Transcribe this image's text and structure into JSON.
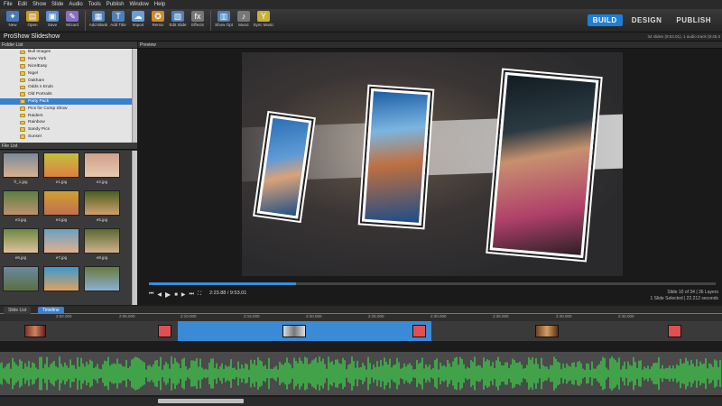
{
  "menu": [
    "File",
    "Edit",
    "Show",
    "Slide",
    "Audio",
    "Tools",
    "Publish",
    "Window",
    "Help"
  ],
  "toolbar": [
    {
      "label": "New",
      "icon": "new-icon",
      "glyph": "✦"
    },
    {
      "label": "Open",
      "icon": "open-icon",
      "glyph": "▤"
    },
    {
      "label": "Save",
      "icon": "save-icon",
      "glyph": "▣"
    },
    {
      "label": "Wizard",
      "icon": "wizard-icon",
      "glyph": "✎"
    },
    {
      "label": "Add Blank",
      "icon": "add-blank-icon",
      "glyph": "▦"
    },
    {
      "label": "Add Title",
      "icon": "add-title-icon",
      "glyph": "T"
    },
    {
      "label": "Import",
      "icon": "import-icon",
      "glyph": "☁"
    },
    {
      "label": "Remix",
      "icon": "remix-icon",
      "glyph": "✪"
    },
    {
      "label": "Edit Slide",
      "icon": "edit-slide-icon",
      "glyph": "▧"
    },
    {
      "label": "Effects",
      "icon": "effects-icon",
      "glyph": "fx"
    },
    {
      "label": "Show Opt",
      "icon": "show-opt-icon",
      "glyph": "▥"
    },
    {
      "label": "Music",
      "icon": "music-icon",
      "glyph": "♪"
    },
    {
      "label": "Sync Music",
      "icon": "sync-music-icon",
      "glyph": "Y"
    }
  ],
  "modes": {
    "build": "BUILD",
    "design": "DESIGN",
    "publish": "PUBLISH"
  },
  "project": {
    "title": "ProShow Slideshow",
    "info": "34 slides (9:53.01), 1 audio track (9:45.3"
  },
  "folder_panel": {
    "title": "Folder List",
    "items": [
      "Bull Images",
      "New York",
      "NicelEasy",
      "Nigel",
      "Oakham",
      "Odds n Ends",
      "Old Portraits",
      "Party Pack",
      "Pics for Comp Show",
      "Raiders",
      "Rainbow",
      "Sandy Pics",
      "Sunset"
    ],
    "selected": 7
  },
  "file_panel": {
    "title": "File List",
    "files": [
      "fr_1.jpg",
      "e1.jpg",
      "e2.jpg",
      "e3.jpg",
      "e4.jpg",
      "e5.jpg",
      "e6.jpg",
      "e7.jpg",
      "e8.jpg",
      "",
      "",
      ""
    ]
  },
  "preview": {
    "title": "Preview"
  },
  "transport": {
    "timecode": "2:23.88 / 9:53.01",
    "slide_info": "Slide 10 of 34 | 36 Layers",
    "slide_info2": "1 Slide Selected | 22.212 seconds",
    "progress": 0.26
  },
  "tabs": {
    "slide_list": "Slide List",
    "timeline": "Timeline"
  },
  "ruler": [
    "2:00.000",
    "2:05.000",
    "2:10.000",
    "2:15.000",
    "2:20.000",
    "2:25.000",
    "2:30.000",
    "2:35.000",
    "2:40.000",
    "2:45.000"
  ],
  "colors": {
    "accent": "#3b8ad6",
    "audio_wave": "#3ec94a",
    "folder": "#e8c14a"
  }
}
